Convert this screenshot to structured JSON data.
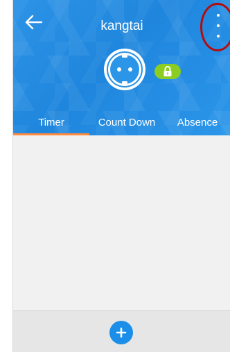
{
  "header": {
    "title": "kangtai",
    "back_icon": "arrow-left-icon",
    "menu_icon": "more-vertical-icon",
    "device_icon": "power-socket-icon",
    "lock_icon": "lock-icon"
  },
  "tabs": [
    {
      "label": "Timer",
      "selected": true
    },
    {
      "label": "Count Down",
      "selected": false
    },
    {
      "label": "Absence",
      "selected": false
    }
  ],
  "footer": {
    "add_icon": "plus-icon"
  },
  "colors": {
    "header_blue": "#1f86dd",
    "tab_indicator": "#ff8a3d",
    "lock_green": "#8ccd22",
    "add_button": "#1a8ee8",
    "annotation_red": "#b30c0c"
  }
}
